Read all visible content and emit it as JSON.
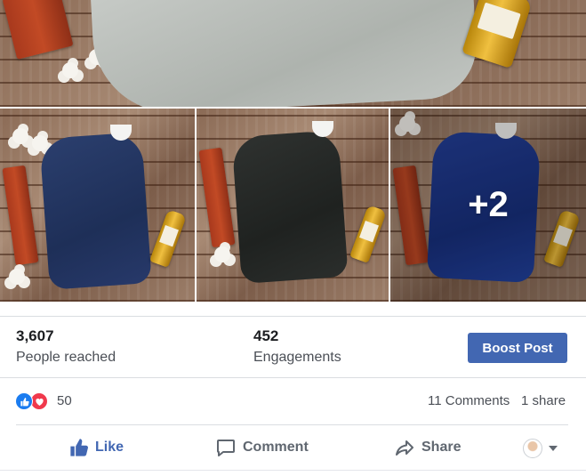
{
  "photos": {
    "more_count": "+2"
  },
  "insights": {
    "reach_value": "3,607",
    "reach_label": "People reached",
    "engagement_value": "452",
    "engagement_label": "Engagements",
    "boost_label": "Boost Post"
  },
  "reactions": {
    "count": "50",
    "icons": [
      "like-icon",
      "love-icon"
    ],
    "comments": "11 Comments",
    "shares": "1 share"
  },
  "actions": {
    "like": "Like",
    "comment": "Comment",
    "share": "Share"
  },
  "colors": {
    "accent": "#4267b2",
    "like_reaction": "#1b7cf0",
    "love_reaction": "#f0394c"
  }
}
